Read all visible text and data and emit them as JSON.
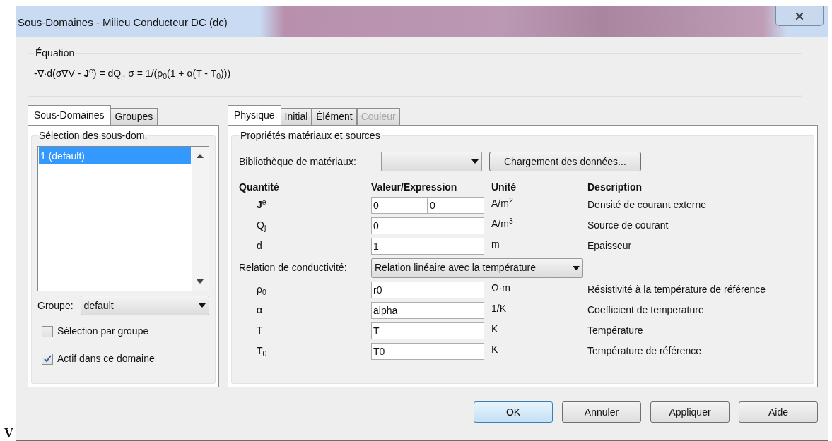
{
  "window": {
    "title": "Sous-Domaines - Milieu Conducteur DC (dc)"
  },
  "equation": {
    "label": "Équation",
    "formula": "-∇·d(σ∇V - **J**$^{e}$) = dQ$_{j}$, σ = 1/(ρ$_{0}$(1 + α(T - T$_{0}$)))"
  },
  "left_tabs": [
    {
      "label": "Sous-Domaines",
      "selected": true
    },
    {
      "label": "Groupes",
      "selected": false
    }
  ],
  "subdomain_selection": {
    "label": "Sélection des sous-dom.",
    "items": [
      {
        "label": "1 (default)",
        "selected": true
      }
    ],
    "group_label": "Groupe:",
    "group_value": "default",
    "checkboxes": [
      {
        "label": "Sélection par groupe",
        "checked": false
      },
      {
        "label": "Actif dans ce domaine",
        "checked": true
      }
    ]
  },
  "right_tabs": [
    {
      "label": "Physique",
      "selected": true,
      "disabled": false
    },
    {
      "label": "Initial",
      "selected": false,
      "disabled": false
    },
    {
      "label": "Élément",
      "selected": false,
      "disabled": false
    },
    {
      "label": "Couleur",
      "selected": false,
      "disabled": true
    }
  ],
  "properties": {
    "label": "Propriétés matériaux et sources",
    "library_label": "Bibliothèque de matériaux:",
    "load_button": "Chargement des données...",
    "columns": [
      "Quantité",
      "Valeur/Expression",
      "Unité",
      "Description"
    ],
    "rows": [
      {
        "kind": "quantity",
        "symbol": "**J**$^{e}$",
        "values": [
          "0",
          "0"
        ],
        "unit": "A/m$^{2}$",
        "description": "Densité de courant externe"
      },
      {
        "kind": "quantity",
        "symbol": "Q$_{j}$",
        "values": [
          "0"
        ],
        "unit": "A/m$^{3}$",
        "description": "Source de courant"
      },
      {
        "kind": "quantity",
        "symbol": "d",
        "values": [
          "1"
        ],
        "unit": "m",
        "description": "Epaisseur"
      },
      {
        "kind": "select",
        "label": "Relation de conductivité:",
        "value": "Relation linéaire avec la température"
      },
      {
        "kind": "quantity",
        "symbol": "ρ$_{0}$",
        "values": [
          "r0"
        ],
        "unit": "Ω·m",
        "description": "Résistivité à la température de référence"
      },
      {
        "kind": "quantity",
        "symbol": "α",
        "values": [
          "alpha"
        ],
        "unit": "1/K",
        "description": "Coefficient de temperature"
      },
      {
        "kind": "quantity",
        "symbol": "T",
        "values": [
          "T"
        ],
        "unit": "K",
        "description": "Température"
      },
      {
        "kind": "quantity",
        "symbol": "T$_{0}$",
        "values": [
          "T0"
        ],
        "unit": "K",
        "description": "Température de référence"
      }
    ]
  },
  "buttons": [
    {
      "label": "OK",
      "default": true
    },
    {
      "label": "Annuler",
      "default": false
    },
    {
      "label": "Appliquer",
      "default": false
    },
    {
      "label": "Aide",
      "default": false
    }
  ],
  "page_fragment": "V"
}
